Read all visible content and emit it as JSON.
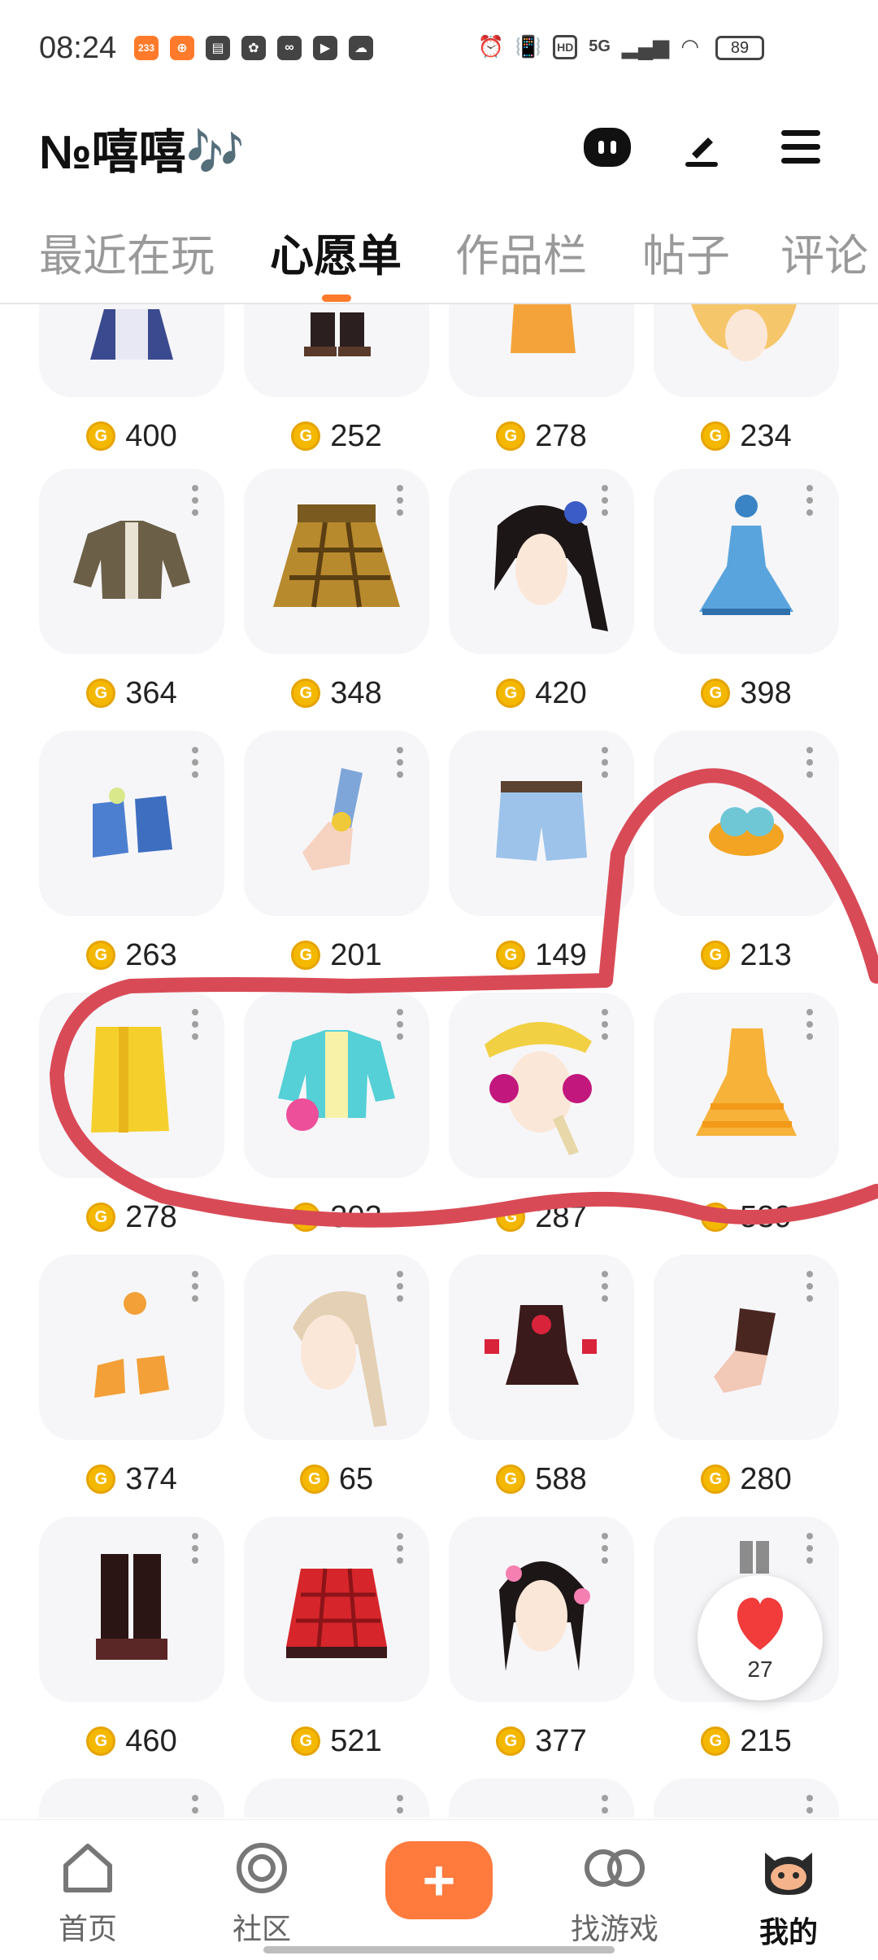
{
  "status_bar": {
    "time": "08:24",
    "notif_badge": "233",
    "network": "5G",
    "hd": "HD",
    "battery": "89"
  },
  "header": {
    "username": "№嘻嘻🎶",
    "icons": [
      "chat-icon",
      "edit-icon",
      "menu-icon"
    ]
  },
  "tabs": [
    {
      "label": "最近在玩",
      "active": false
    },
    {
      "label": "心愿单",
      "active": true
    },
    {
      "label": "作品栏",
      "active": false
    },
    {
      "label": "帖子",
      "active": false
    },
    {
      "label": "评论",
      "active": false
    }
  ],
  "items": [
    {
      "item": "dress-icon",
      "price": "400"
    },
    {
      "item": "boots-icon",
      "price": "252"
    },
    {
      "item": "top-icon",
      "price": "278"
    },
    {
      "item": "hair-icon",
      "price": "234"
    },
    {
      "item": "jacket-icon",
      "price": "364"
    },
    {
      "item": "skirt-icon",
      "price": "348"
    },
    {
      "item": "hair-icon",
      "price": "420"
    },
    {
      "item": "dress-icon",
      "price": "398"
    },
    {
      "item": "shoes-icon",
      "price": "263"
    },
    {
      "item": "glove-icon",
      "price": "201"
    },
    {
      "item": "shorts-icon",
      "price": "149"
    },
    {
      "item": "accessory-icon",
      "price": "213"
    },
    {
      "item": "skirt-icon",
      "price": "278"
    },
    {
      "item": "jacket-icon",
      "price": "302"
    },
    {
      "item": "hat-icon",
      "price": "287"
    },
    {
      "item": "dress-icon",
      "price": "539"
    },
    {
      "item": "shoes-icon",
      "price": "374"
    },
    {
      "item": "hair-icon",
      "price": "65"
    },
    {
      "item": "outfit-icon",
      "price": "588"
    },
    {
      "item": "glove-icon",
      "price": "280"
    },
    {
      "item": "boots-icon",
      "price": "460"
    },
    {
      "item": "skirt-icon",
      "price": "521"
    },
    {
      "item": "hair-icon",
      "price": "377"
    },
    {
      "item": "accessory-icon",
      "price": "215"
    }
  ],
  "favorite": {
    "count": "27"
  },
  "bottom_nav": [
    {
      "label": "首页",
      "icon": "home-icon"
    },
    {
      "label": "社区",
      "icon": "community-icon"
    },
    {
      "label": "",
      "icon": "plus-icon"
    },
    {
      "label": "找游戏",
      "icon": "find-games-icon"
    },
    {
      "label": "我的",
      "icon": "profile-icon",
      "active": true
    }
  ],
  "colors": {
    "accent": "#ff7a3d",
    "coin": "#f5b800",
    "annotation": "#d94a57",
    "card_bg": "#f6f6f9"
  }
}
